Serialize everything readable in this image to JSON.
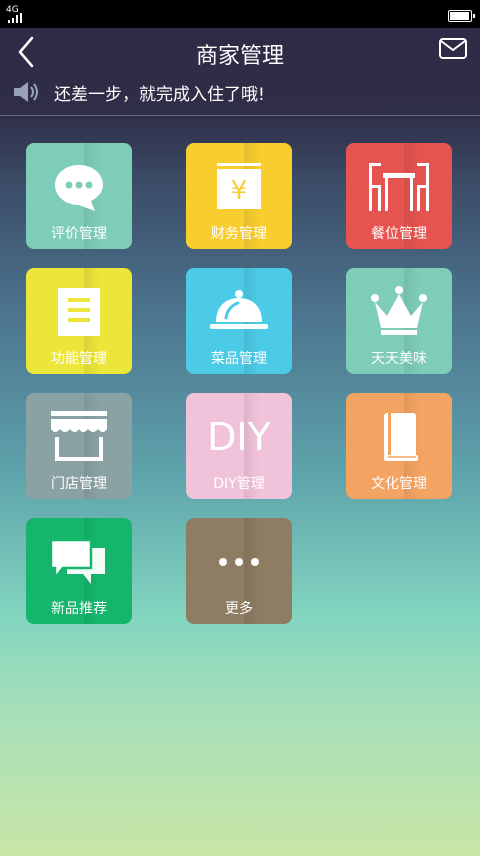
{
  "status_bar": {
    "network": "4G",
    "battery_level": 0.95
  },
  "header": {
    "title": "商家管理"
  },
  "notice": {
    "text": "还差一步，就完成入住了哦!"
  },
  "tiles": [
    {
      "label": "评价管理",
      "color": "#7ecdb8",
      "icon": "chat-bubble-icon"
    },
    {
      "label": "财务管理",
      "color": "#f8ce2f",
      "icon": "yen-ledger-icon"
    },
    {
      "label": "餐位管理",
      "color": "#e5544f",
      "icon": "table-chairs-icon"
    },
    {
      "label": "功能管理",
      "color": "#ece63a",
      "icon": "document-list-icon"
    },
    {
      "label": "菜品管理",
      "color": "#4ccbe7",
      "icon": "food-cloche-icon"
    },
    {
      "label": "天天美味",
      "color": "#7ecdb8",
      "icon": "crown-icon"
    },
    {
      "label": "门店管理",
      "color": "#8aa2a4",
      "icon": "storefront-icon"
    },
    {
      "label": "DIY管理",
      "color": "#f1c3da",
      "icon": "diy-text-icon",
      "glyph_text": "DIY"
    },
    {
      "label": "文化管理",
      "color": "#f4a462",
      "icon": "book-icon"
    },
    {
      "label": "新品推荐",
      "color": "#15b66b",
      "icon": "chat-bubbles-icon"
    },
    {
      "label": "更多",
      "color": "#8e7c63",
      "icon": "more-dots-icon"
    }
  ]
}
